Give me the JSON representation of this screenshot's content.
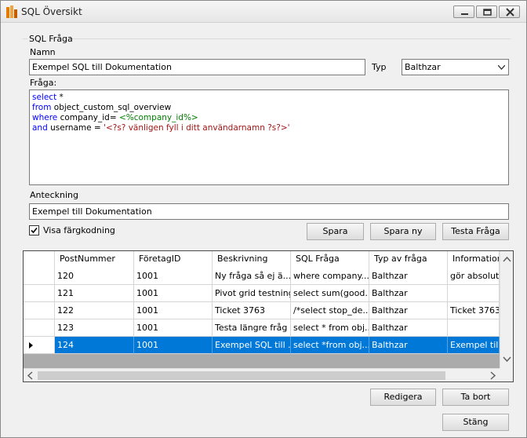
{
  "window": {
    "title": "SQL Översikt"
  },
  "group": {
    "label": "SQL Fråga"
  },
  "form": {
    "name_label": "Namn",
    "name_value": "Exempel SQL till Dokumentation",
    "type_label": "Typ",
    "type_value": "Balthzar",
    "query_label": "Fråga:",
    "query_lines": [
      {
        "kw": "select",
        "rest": " *"
      },
      {
        "kw": "from",
        "rest": " object_custom_sql_overview"
      },
      {
        "kw": "where",
        "rest": " company_id= ",
        "grn": "<%company_id%>"
      },
      {
        "kw": "and",
        "rest": " username = ",
        "red": "'<?s? vänligen fyll i ditt användarnamn ?s?>'"
      }
    ],
    "note_label": "Anteckning",
    "note_value": "Exempel till Dokumentation",
    "color_label": "Visa färgkodning",
    "color_checked": true
  },
  "buttons": {
    "save": "Spara",
    "save_new": "Spara ny",
    "test": "Testa Fråga",
    "edit": "Redigera",
    "delete": "Ta bort",
    "close": "Stäng"
  },
  "grid": {
    "columns": [
      "PostNummer",
      "FöretagID",
      "Beskrivning",
      "SQL Fråga",
      "Typ av fråga",
      "Information"
    ],
    "rows": [
      [
        "120",
        "1001",
        "Ny fråga så ej ä...",
        "where company...",
        "Balthzar",
        "gör absolut in"
      ],
      [
        "121",
        "1001",
        "Pivot grid testning",
        "select sum(good...",
        "Balthzar",
        ""
      ],
      [
        "122",
        "1001",
        "Ticket 3763",
        "/*select stop_de...",
        "Balthzar",
        "Ticket 3763"
      ],
      [
        "123",
        "1001",
        "Testa längre fråg",
        "select * from obj...",
        "Balthzar",
        ""
      ],
      [
        "124",
        "1001",
        "Exempel SQL till ...",
        "select *from obj...",
        "Balthzar",
        "Exempel till Do"
      ]
    ],
    "selected_row": 4
  }
}
